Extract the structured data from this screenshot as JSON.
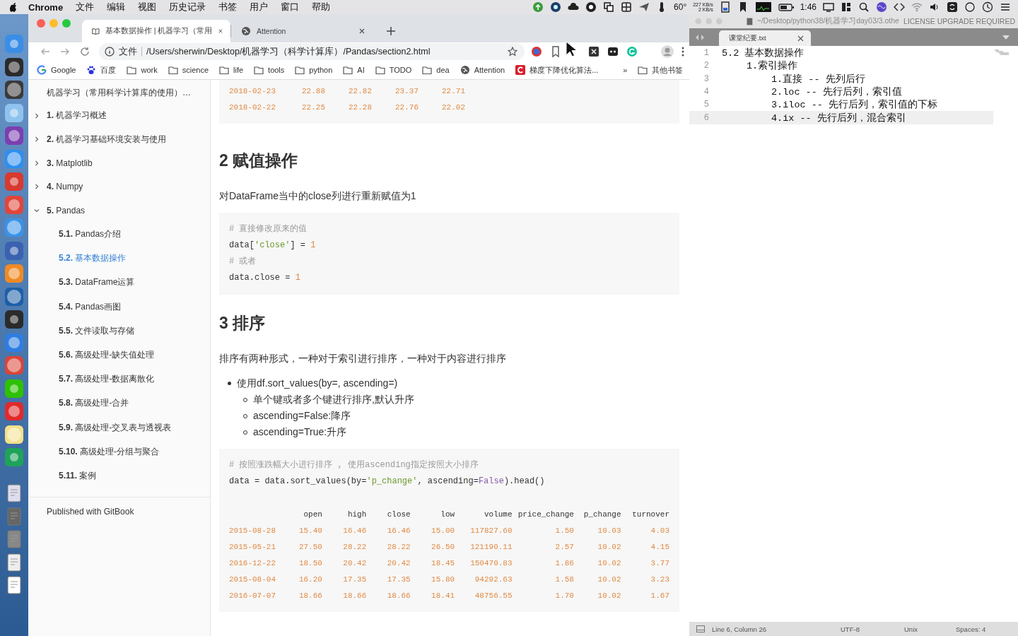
{
  "menubar": {
    "app": "Chrome",
    "menus": [
      "文件",
      "编辑",
      "视图",
      "历史记录",
      "书签",
      "用户",
      "窗口",
      "帮助"
    ],
    "temperature": "60°",
    "net_up": "227 KB/s",
    "net_down": "2 KB/s",
    "battery_time": "1:46"
  },
  "browser": {
    "tabs": [
      {
        "title": "基本数据操作 | 机器学习（常用",
        "kind": "book",
        "selected": true
      },
      {
        "title": "Attention",
        "kind": "globe",
        "selected": false
      }
    ],
    "address": {
      "scheme_label": "文件",
      "url": "/Users/sherwin/Desktop/机器学习（科学计算库）/Pandas/section2.html"
    },
    "bookmarks": [
      {
        "label": "Google",
        "kind": "google"
      },
      {
        "label": "百度",
        "kind": "paw"
      },
      {
        "label": "work",
        "kind": "folder"
      },
      {
        "label": "science",
        "kind": "folder"
      },
      {
        "label": "life",
        "kind": "folder"
      },
      {
        "label": "tools",
        "kind": "folder"
      },
      {
        "label": "python",
        "kind": "folder"
      },
      {
        "label": "AI",
        "kind": "folder"
      },
      {
        "label": "TODO",
        "kind": "folder"
      },
      {
        "label": "dea",
        "kind": "folder"
      },
      {
        "label": "Attention",
        "kind": "globe"
      },
      {
        "label": "梯度下降优化算法...",
        "kind": "red"
      }
    ],
    "bookmarks_more": "»",
    "other_bookmarks": "其他书签"
  },
  "sidebar": {
    "title": "机器学习（常用科学计算库的使用）…",
    "items": [
      {
        "number": "1.",
        "label": "机器学习概述",
        "expanded": false
      },
      {
        "number": "2.",
        "label": "机器学习基础环境安装与使用",
        "expanded": false
      },
      {
        "number": "3.",
        "label": "Matplotlib",
        "expanded": false
      },
      {
        "number": "4.",
        "label": "Numpy",
        "expanded": false
      },
      {
        "number": "5.",
        "label": "Pandas",
        "expanded": true,
        "children": [
          {
            "number": "5.1.",
            "label": "Pandas介绍",
            "selected": false
          },
          {
            "number": "5.2.",
            "label": "基本数据操作",
            "selected": true
          },
          {
            "number": "5.3.",
            "label": "DataFrame运算",
            "selected": false
          },
          {
            "number": "5.4.",
            "label": "Pandas画图",
            "selected": false
          },
          {
            "number": "5.5.",
            "label": "文件读取与存储",
            "selected": false
          },
          {
            "number": "5.6.",
            "label": "高级处理-缺失值处理",
            "selected": false
          },
          {
            "number": "5.7.",
            "label": "高级处理-数据离散化",
            "selected": false
          },
          {
            "number": "5.8.",
            "label": "高级处理-合并",
            "selected": false
          },
          {
            "number": "5.9.",
            "label": "高级处理-交叉表与透视表",
            "selected": false
          },
          {
            "number": "5.10.",
            "label": "高级处理-分组与聚合",
            "selected": false
          },
          {
            "number": "5.11.",
            "label": "案例",
            "selected": false
          }
        ]
      }
    ],
    "footer": "Published with GitBook"
  },
  "page": {
    "blocks": [
      {
        "kind": "code",
        "table": {
          "rows": [
            {
              "index": "2018-02-23",
              "values": [
                "22.88",
                "22.82",
                "23.37",
                "22.71"
              ]
            },
            {
              "index": "2018-02-22",
              "values": [
                "22.25",
                "22.28",
                "22.76",
                "22.02"
              ]
            }
          ]
        }
      },
      {
        "kind": "heading",
        "text": "2 赋值操作"
      },
      {
        "kind": "paragraph",
        "text": "对DataFrame当中的close列进行重新赋值为1"
      },
      {
        "kind": "code",
        "lines": [
          [
            {
              "t": "# 直接修改原来的值",
              "kind": "comment"
            }
          ],
          [
            {
              "t": "data[",
              "kind": "plain"
            },
            {
              "t": "'close'",
              "kind": "string"
            },
            {
              "t": "] = ",
              "kind": "plain"
            },
            {
              "t": "1",
              "kind": "number"
            }
          ],
          [
            {
              "t": "# 或者",
              "kind": "comment"
            }
          ],
          [
            {
              "t": "data.close = ",
              "kind": "plain"
            },
            {
              "t": "1",
              "kind": "number"
            }
          ]
        ]
      },
      {
        "kind": "heading",
        "text": "3 排序"
      },
      {
        "kind": "paragraph",
        "text": "排序有两种形式，一种对于索引进行排序，一种对于内容进行排序"
      },
      {
        "kind": "list",
        "items": [
          {
            "text": "使用df.sort_values(by=, ascending=)",
            "children": [
              {
                "text": "单个键或者多个键进行排序,默认升序"
              },
              {
                "text": "ascending=False:降序"
              },
              {
                "text": "ascending=True:升序"
              }
            ]
          }
        ]
      },
      {
        "kind": "code",
        "lines": [
          [
            {
              "t": "# 按照涨跌幅大小进行排序 , 使用ascending指定按照大小排序",
              "kind": "comment"
            }
          ],
          [
            {
              "t": "data = data.sort_values(by=",
              "kind": "plain"
            },
            {
              "t": "'p_change'",
              "kind": "string"
            },
            {
              "t": ", ascending=",
              "kind": "plain"
            },
            {
              "t": "False",
              "kind": "keyword"
            },
            {
              "t": ").head()",
              "kind": "plain"
            }
          ]
        ],
        "table": {
          "columns": [
            "open",
            "high",
            "close",
            "low",
            "volume",
            "price_change",
            "p_change",
            "turnover"
          ],
          "rows": [
            {
              "index": "2015-08-28",
              "values": [
                "15.40",
                "16.46",
                "16.46",
                "15.00",
                "117827.60",
                "1.50",
                "10.03",
                "4.03"
              ]
            },
            {
              "index": "2015-05-21",
              "values": [
                "27.50",
                "28.22",
                "28.22",
                "26.50",
                "121190.11",
                "2.57",
                "10.02",
                "4.15"
              ]
            },
            {
              "index": "2016-12-22",
              "values": [
                "18.50",
                "20.42",
                "20.42",
                "18.45",
                "150470.83",
                "1.86",
                "10.02",
                "3.77"
              ]
            },
            {
              "index": "2015-08-04",
              "values": [
                "16.20",
                "17.35",
                "17.35",
                "15.80",
                "94292.63",
                "1.58",
                "10.02",
                "3.23"
              ]
            },
            {
              "index": "2016-07-07",
              "values": [
                "18.66",
                "18.66",
                "18.66",
                "18.41",
                "48756.55",
                "1.70",
                "10.02",
                "1.67"
              ]
            }
          ]
        }
      }
    ]
  },
  "editor": {
    "title_path": "~/Desktop/python38/机器学习day03/3.othe",
    "license_notice": "LICENSE UPGRADE REQUIRED",
    "tab": "课堂纪要.txt",
    "lines": [
      {
        "number": "1",
        "text": "5.2 基本数据操作",
        "current": false,
        "children": [
          {
            "number": "2",
            "text": "1.索引操作",
            "current": false,
            "children": [
              {
                "number": "3",
                "text": "1.直接 -- 先列后行",
                "current": false
              },
              {
                "number": "4",
                "text": "2.loc -- 先行后列，索引值",
                "current": false
              },
              {
                "number": "5",
                "text": "3.iloc -- 先行后列，索引值的下标",
                "current": false
              },
              {
                "number": "6",
                "text": "4.ix -- 先行后列，混合索引",
                "current": true
              }
            ]
          }
        ]
      }
    ],
    "status": {
      "position": "Line 6, Column 26",
      "encoding": "UTF-8",
      "line_endings": "Unix",
      "indentation": "Spaces: 4"
    }
  }
}
